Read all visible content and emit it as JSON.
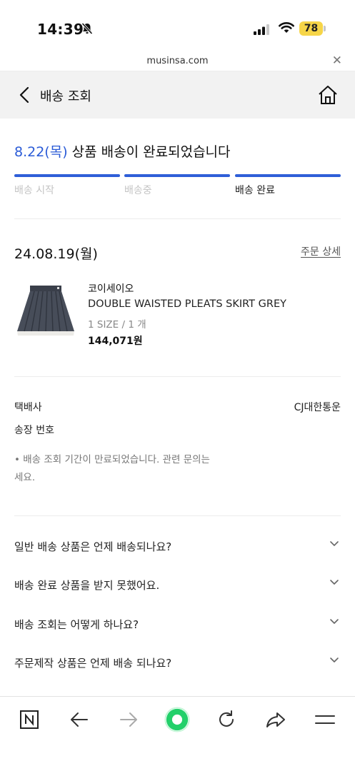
{
  "status_bar": {
    "time": "14:39",
    "battery": "78",
    "bell_icon": "bell-slash-icon",
    "signal_icon": "cellular-signal-icon",
    "wifi_icon": "wifi-icon"
  },
  "browser": {
    "url": "musinsa.com",
    "close_icon": "close-icon"
  },
  "header": {
    "title": "배송 조회",
    "back_icon": "chevron-left-icon",
    "home_icon": "home-icon"
  },
  "delivery": {
    "date": "8.22(목)",
    "message": " 상품 배송이 완료되었습니다",
    "progress": 1.0,
    "accent_color": "#2f5fd8",
    "steps": [
      {
        "label": "배송 시작",
        "active": false
      },
      {
        "label": "배송중",
        "active": false
      },
      {
        "label": "배송 완료",
        "active": true
      }
    ]
  },
  "order": {
    "date": "24.08.19(월)",
    "detail_link": "주문 상세",
    "product": {
      "brand": "코이세이오",
      "name": "DOUBLE WAISTED PLEATS SKIRT GREY",
      "option": "1 SIZE / 1 개",
      "price": "144,071원"
    }
  },
  "shipping": {
    "courier_label": "택배사",
    "courier_value": "CJ대한통운",
    "tracking_label": "송장 번호",
    "notice_line1": "• 배송 조회 기간이 만료되었습니다. 관련 문의는",
    "notice_line2": "세요."
  },
  "faq": [
    {
      "question": "일반 배송 상품은 언제 배송되나요?"
    },
    {
      "question": "배송 완료 상품을 받지 못했어요."
    },
    {
      "question": "배송 조회는 어떻게 하나요?"
    },
    {
      "question": "주문제작 상품은 언제 배송 되나요?"
    }
  ],
  "toolbar": {
    "icons": [
      "naver-n-icon",
      "arrow-left-icon",
      "arrow-right-icon",
      "green-dot-icon",
      "refresh-icon",
      "share-icon",
      "menu-icon"
    ]
  }
}
